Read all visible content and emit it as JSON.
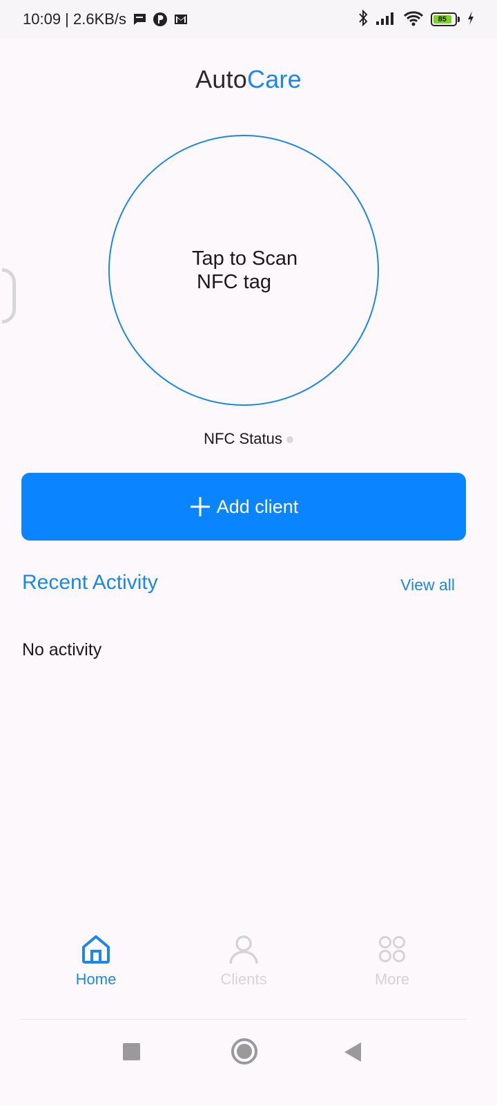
{
  "status_bar": {
    "time_speed": "10:09 | 2.6KB/s",
    "battery_level": "85",
    "icons": [
      "message-icon",
      "app-p-icon",
      "mail-icon",
      "bluetooth-icon",
      "signal-icon",
      "wifi-icon",
      "battery-icon",
      "charging-icon"
    ]
  },
  "header": {
    "title_part1": "Auto",
    "title_part2": "Care"
  },
  "scan": {
    "line1": "Tap to Scan",
    "line2": "NFC tag"
  },
  "nfc_status": {
    "label": "NFC Status"
  },
  "add_client": {
    "label": "Add client"
  },
  "recent": {
    "title": "Recent Activity",
    "view_all": "View all",
    "empty_text": "No activity"
  },
  "tabs": [
    {
      "label": "Home",
      "icon": "home-icon",
      "active": true
    },
    {
      "label": "Clients",
      "icon": "user-icon",
      "active": false
    },
    {
      "label": "More",
      "icon": "grid-icon",
      "active": false
    }
  ],
  "colors": {
    "accent": "#1a87ee",
    "button": "#0a84ff",
    "background": "#fdf8fc",
    "inactive": "#d4d4d4"
  }
}
